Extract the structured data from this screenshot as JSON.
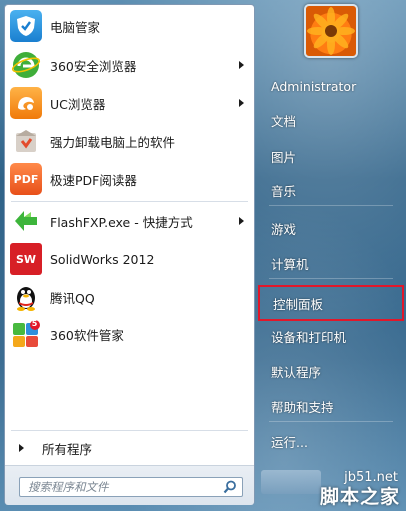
{
  "programs": [
    {
      "label": "电脑管家",
      "icon": "tencent-pc-manager-icon",
      "has_submenu": false
    },
    {
      "label": "360安全浏览器",
      "icon": "360-browser-icon",
      "has_submenu": true
    },
    {
      "label": "UC浏览器",
      "icon": "uc-browser-icon",
      "has_submenu": true
    },
    {
      "label": "强力卸载电脑上的软件",
      "icon": "uninstaller-icon",
      "has_submenu": false
    },
    {
      "label": "极速PDF阅读器",
      "icon": "pdf-reader-icon",
      "has_submenu": false
    },
    {
      "label": "FlashFXP.exe - 快捷方式",
      "icon": "flashfxp-icon",
      "has_submenu": true
    },
    {
      "label": "SolidWorks 2012",
      "icon": "solidworks-icon",
      "has_submenu": false
    },
    {
      "label": "腾讯QQ",
      "icon": "qq-penguin-icon",
      "has_submenu": false
    },
    {
      "label": "360软件管家",
      "icon": "360-software-manager-icon",
      "has_submenu": false
    }
  ],
  "icon_text": {
    "pdf": "PDF",
    "sw": "SW",
    "badge": "5"
  },
  "all_programs_label": "所有程序",
  "search": {
    "placeholder": "搜索程序和文件"
  },
  "right_menu": [
    {
      "label": "Administrator"
    },
    {
      "label": "文档"
    },
    {
      "label": "图片"
    },
    {
      "label": "音乐"
    },
    {
      "label": "游戏"
    },
    {
      "label": "计算机"
    },
    {
      "label": "控制面板",
      "highlighted": true
    },
    {
      "label": "设备和打印机"
    },
    {
      "label": "默认程序"
    },
    {
      "label": "帮助和支持"
    },
    {
      "label": "运行..."
    }
  ],
  "watermark": {
    "line1": "jb51.net",
    "line2": "脚本之家"
  },
  "colors": {
    "highlight_border": "#e2172a",
    "panel_blue": "#2f6288"
  }
}
